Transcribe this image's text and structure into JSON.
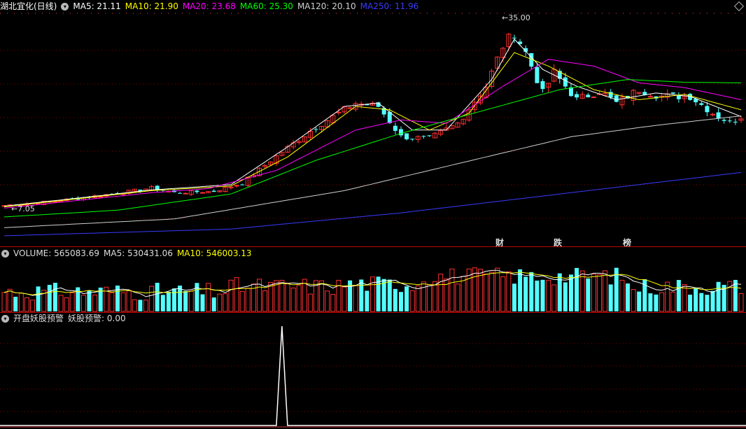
{
  "header": {
    "title": "湖北宜化(日线)",
    "ma": [
      {
        "label": "MA5: 21.11",
        "color": "#ffffff"
      },
      {
        "label": "MA10: 21.90",
        "color": "#ffff00"
      },
      {
        "label": "MA20: 23.68",
        "color": "#ff00ff"
      },
      {
        "label": "MA60: 25.30",
        "color": "#00ff00"
      },
      {
        "label": "MA120: 20.10",
        "color": "#cfcfcf"
      },
      {
        "label": "MA250: 11.96",
        "color": "#3a3aff"
      }
    ]
  },
  "price_annotations": {
    "high": "35.00",
    "low": "7.05"
  },
  "markers": [
    {
      "label": "财",
      "color": "#4a90ff"
    },
    {
      "label": "跌",
      "color": "#44ff44"
    },
    {
      "label": "榜",
      "color": "#ff9944"
    }
  ],
  "volume_header": {
    "items": [
      {
        "label": "VOLUME: 565083.69",
        "color": "#dddddd"
      },
      {
        "label": "MA5: 530431.06",
        "color": "#dddddd"
      },
      {
        "label": "MA10: 546003.13",
        "color": "#ffff00"
      }
    ]
  },
  "indicator_header": {
    "items": [
      {
        "label": "开盘妖股预警",
        "color": "#dddddd"
      },
      {
        "label": "妖股预警: 0.00",
        "color": "#dddddd"
      }
    ]
  },
  "colors": {
    "up": "#ff3030",
    "down": "#54ffff",
    "grid": "#8a0000",
    "divider": "#c00000"
  },
  "chart_data": {
    "type": "candlestick",
    "close_anchors": [
      [
        0,
        7.3
      ],
      [
        10,
        8.0
      ],
      [
        20,
        9.1
      ],
      [
        26,
        9.9
      ],
      [
        30,
        9.2
      ],
      [
        37,
        9.4
      ],
      [
        42,
        10.6
      ],
      [
        48,
        14.6
      ],
      [
        55,
        19.0
      ],
      [
        62,
        22.5
      ],
      [
        66,
        22.0
      ],
      [
        70,
        17.5
      ],
      [
        75,
        17.2
      ],
      [
        80,
        19.5
      ],
      [
        85,
        25.0
      ],
      [
        88,
        31.0
      ],
      [
        90,
        33.0
      ],
      [
        92,
        30.0
      ],
      [
        95,
        24.0
      ],
      [
        97,
        27.0
      ],
      [
        99,
        25.0
      ],
      [
        101,
        23.0
      ],
      [
        105,
        24.3
      ],
      [
        108,
        22.5
      ],
      [
        112,
        24.5
      ],
      [
        116,
        23.5
      ],
      [
        121,
        23.5
      ],
      [
        125,
        21.0
      ],
      [
        128,
        19.6
      ],
      [
        130,
        20.5
      ]
    ],
    "ma_anchors": {
      "MA5": [
        [
          0,
          7.2
        ],
        [
          26,
          9.6
        ],
        [
          40,
          10.4
        ],
        [
          50,
          16.0
        ],
        [
          60,
          22.0
        ],
        [
          66,
          22.5
        ],
        [
          72,
          18.5
        ],
        [
          78,
          18.5
        ],
        [
          86,
          26.0
        ],
        [
          90,
          32.0
        ],
        [
          95,
          27.5
        ],
        [
          101,
          25.0
        ],
        [
          108,
          23.0
        ],
        [
          115,
          24.0
        ],
        [
          121,
          23.5
        ],
        [
          130,
          20.5
        ]
      ],
      "MA10": [
        [
          0,
          7.1
        ],
        [
          26,
          9.5
        ],
        [
          40,
          10.2
        ],
        [
          50,
          14.5
        ],
        [
          62,
          22.0
        ],
        [
          68,
          21.5
        ],
        [
          75,
          18.5
        ],
        [
          82,
          21.0
        ],
        [
          90,
          30.0
        ],
        [
          96,
          28.0
        ],
        [
          104,
          24.5
        ],
        [
          112,
          23.0
        ],
        [
          120,
          23.8
        ],
        [
          130,
          21.5
        ]
      ],
      "MA20": [
        [
          0,
          6.9
        ],
        [
          26,
          9.2
        ],
        [
          36,
          9.8
        ],
        [
          48,
          12.5
        ],
        [
          62,
          18.5
        ],
        [
          70,
          20.0
        ],
        [
          78,
          19.5
        ],
        [
          88,
          25.0
        ],
        [
          96,
          29.0
        ],
        [
          104,
          28.0
        ],
        [
          112,
          25.5
        ],
        [
          120,
          24.8
        ],
        [
          130,
          23.0
        ]
      ],
      "MA60": [
        [
          0,
          5.6
        ],
        [
          20,
          6.6
        ],
        [
          40,
          9.0
        ],
        [
          55,
          14.0
        ],
        [
          70,
          18.0
        ],
        [
          85,
          21.5
        ],
        [
          98,
          24.5
        ],
        [
          110,
          26.0
        ],
        [
          120,
          25.6
        ],
        [
          130,
          25.5
        ]
      ],
      "MA120": [
        [
          0,
          4.0
        ],
        [
          30,
          5.3
        ],
        [
          60,
          9.5
        ],
        [
          80,
          13.5
        ],
        [
          100,
          17.5
        ],
        [
          115,
          19.2
        ],
        [
          130,
          20.6
        ]
      ],
      "MA250": [
        [
          0,
          2.8
        ],
        [
          40,
          3.8
        ],
        [
          70,
          6.2
        ],
        [
          100,
          9.2
        ],
        [
          130,
          12.2
        ]
      ]
    },
    "ylim": [
      1.0,
      37.5
    ],
    "volume": {
      "last": 565083.69,
      "ma5": 530431.06,
      "ma10": 546003.13,
      "max": 1000000
    },
    "signal": {
      "spike_index": 49,
      "value_at_spike": 1.0,
      "current": 0.0
    }
  }
}
